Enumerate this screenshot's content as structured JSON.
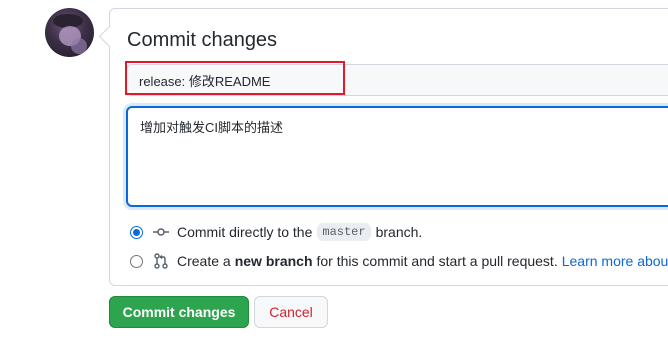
{
  "form": {
    "title": "Commit changes",
    "summary_value": "release: 修改README",
    "description_value": "增加对触发CI脚本的描述"
  },
  "options": {
    "direct": {
      "prefix": "Commit directly to the",
      "branch": "master",
      "suffix": "branch.",
      "checked": true
    },
    "new_branch": {
      "prefix": "Create a",
      "strong": "new branch",
      "suffix": "for this commit and start a pull request.",
      "link": "Learn more about",
      "checked": false
    }
  },
  "buttons": {
    "commit_label": "Commit changes",
    "cancel_label": "Cancel"
  },
  "colors": {
    "commit_green": "#2da44e",
    "focus_blue": "#0969da",
    "annotation_red": "#e0192e",
    "cancel_red": "#cf222e"
  },
  "icons": {
    "direct": "git-commit-icon",
    "new_branch": "git-pull-request-icon"
  }
}
